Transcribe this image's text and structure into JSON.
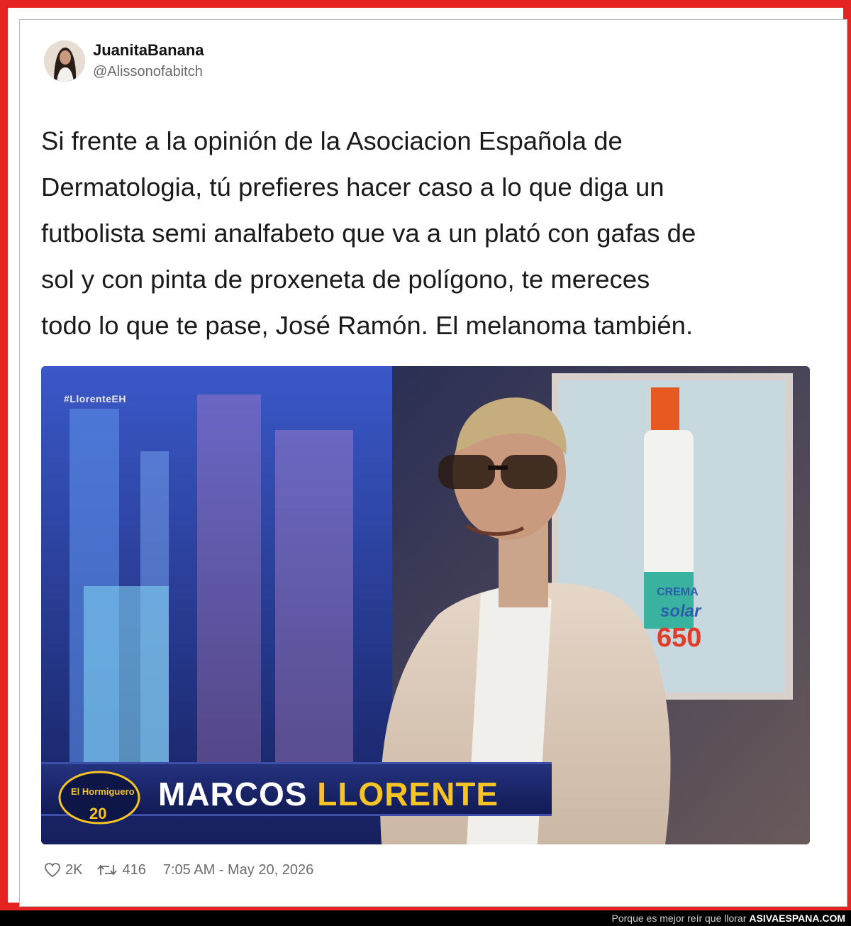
{
  "tweet": {
    "author_name": "JuanitaBanana",
    "author_handle": "@Alissonofabitch",
    "text": "Si frente a la opinión de la Asociacion Española de\nDermatologia, tú prefieres hacer caso a lo que diga un\nfutbolista semi analfabeto que va a un plató con gafas de\nsol y con pinta de proxeneta de polígono, te mereces\ntodo lo que te pase, José Ramón. El melanoma también.",
    "likes": "2K",
    "retweets": "416",
    "timestamp": "7:05 AM - May 20, 2026"
  },
  "media": {
    "hashtag": "#LlorenteEH",
    "lower_third_first": "MARCOS ",
    "lower_third_last": "LLORENTE",
    "show_logo_text": "El Hormiguero",
    "show_logo_number": "20",
    "bottle_brand": "CREMA",
    "bottle_product": "solar",
    "bottle_spf": "650"
  },
  "footer": {
    "slogan": "Porque es mejor reír que llorar",
    "brand": "ASIVAESPANA.COM"
  },
  "colors": {
    "frame_red": "#e52421",
    "lower_third_blue": "#1b2a72",
    "name_yellow": "#f6c425"
  },
  "icons": [
    "avatar-photo",
    "heart-icon",
    "retweet-icon"
  ]
}
